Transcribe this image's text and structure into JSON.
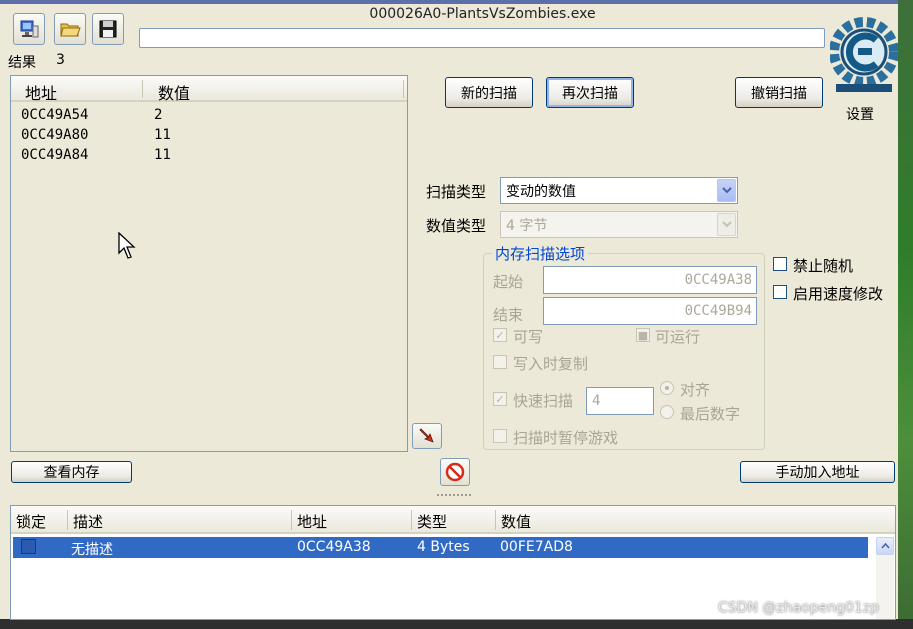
{
  "app": {
    "window_title": "000026A0-PlantsVsZombies.exe",
    "settings_label": "设置",
    "logo_name": "cheat-engine-logo"
  },
  "results": {
    "label": "结果",
    "count": "3",
    "col_address": "地址",
    "col_value": "数值",
    "rows": [
      {
        "address": "0CC49A54",
        "value": "2"
      },
      {
        "address": "0CC49A80",
        "value": "11"
      },
      {
        "address": "0CC49A84",
        "value": "11"
      }
    ]
  },
  "scan_buttons": {
    "new_scan": "新的扫描",
    "next_scan": "再次扫描",
    "undo_scan": "撤销扫描"
  },
  "scan_options": {
    "scan_type_label": "扫描类型",
    "scan_type_value": "变动的数值",
    "value_type_label": "数值类型",
    "value_type_value": "4 字节",
    "memory_group_title": "内存扫描选项",
    "start_label": "起始",
    "start_value": "0CC49A38",
    "end_label": "结束",
    "end_value": "0CC49B94",
    "writable_label": "可写",
    "executable_label": "可运行",
    "copy_on_write_label": "写入时复制",
    "fast_scan_label": "快速扫描",
    "fast_scan_value": "4",
    "align_label": "对齐",
    "last_digits_label": "最后数字",
    "pause_game_label": "扫描时暂停游戏",
    "disable_random_label": "禁止随机",
    "speedhack_label": "启用速度修改"
  },
  "bottom_buttons": {
    "view_memory": "查看内存",
    "add_address_manually": "手动加入地址"
  },
  "address_table": {
    "col_lock": "锁定",
    "col_description": "描述",
    "col_address": "地址",
    "col_type": "类型",
    "col_value": "数值",
    "rows": [
      {
        "description": "无描述",
        "address": "0CC49A38",
        "type": "4 Bytes",
        "value": "00FE7AD8"
      }
    ]
  },
  "watermark": "CSDN @zhaopeng01zp",
  "colors": {
    "window_bg": "#ece9d8",
    "selection": "#316ac5",
    "group_title": "#0046d5"
  }
}
